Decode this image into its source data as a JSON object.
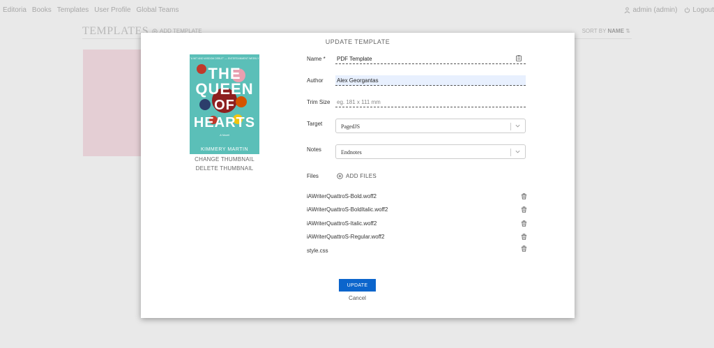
{
  "topnav": {
    "items": [
      "Editoria",
      "Books",
      "Templates",
      "User Profile",
      "Global Teams"
    ],
    "user": "admin (admin)",
    "logout": "Logout"
  },
  "background": {
    "title": "TEMPLATES",
    "add_template": "ADD TEMPLATE",
    "sort_label": "SORT BY",
    "sort_value": "NAME"
  },
  "modal": {
    "title": "UPDATE TEMPLATE",
    "cover": {
      "tagline": "\"A WIT AND WISDOM DEBUT\" — ENTERTAINMENT WEEKLY",
      "title_lines": [
        "THE",
        "QUEEN",
        "OF",
        "HEARTS"
      ],
      "subtitle": "A Novel",
      "author": "KIMMERY MARTIN",
      "color": "#5bbfb8"
    },
    "change_thumbnail": "CHANGE THUMBNAIL",
    "delete_thumbnail": "DELETE THUMBNAIL",
    "fields": {
      "name_label": "Name *",
      "name_value": "PDF Template",
      "author_label": "Author",
      "author_value": "Alex Georgantas",
      "trim_label": "Trim Size",
      "trim_placeholder": "eg. 181 x 111 mm",
      "target_label": "Target",
      "target_value": "PagedJS",
      "notes_label": "Notes",
      "notes_value": "Endnotes",
      "files_label": "Files",
      "add_files": "ADD FILES"
    },
    "files": [
      {
        "name": "iAWriterQuattroS-Bold.woff2",
        "deletable": true
      },
      {
        "name": "iAWriterQuattroS-BoldItalic.woff2",
        "deletable": true
      },
      {
        "name": "iAWriterQuattroS-Italic.woff2",
        "deletable": true
      },
      {
        "name": "iAWriterQuattroS-Regular.woff2",
        "deletable": true
      },
      {
        "name": "style.css",
        "deletable": false
      }
    ],
    "update_button": "UPDATE",
    "cancel_button": "Cancel",
    "accent": "#0b65cc"
  }
}
